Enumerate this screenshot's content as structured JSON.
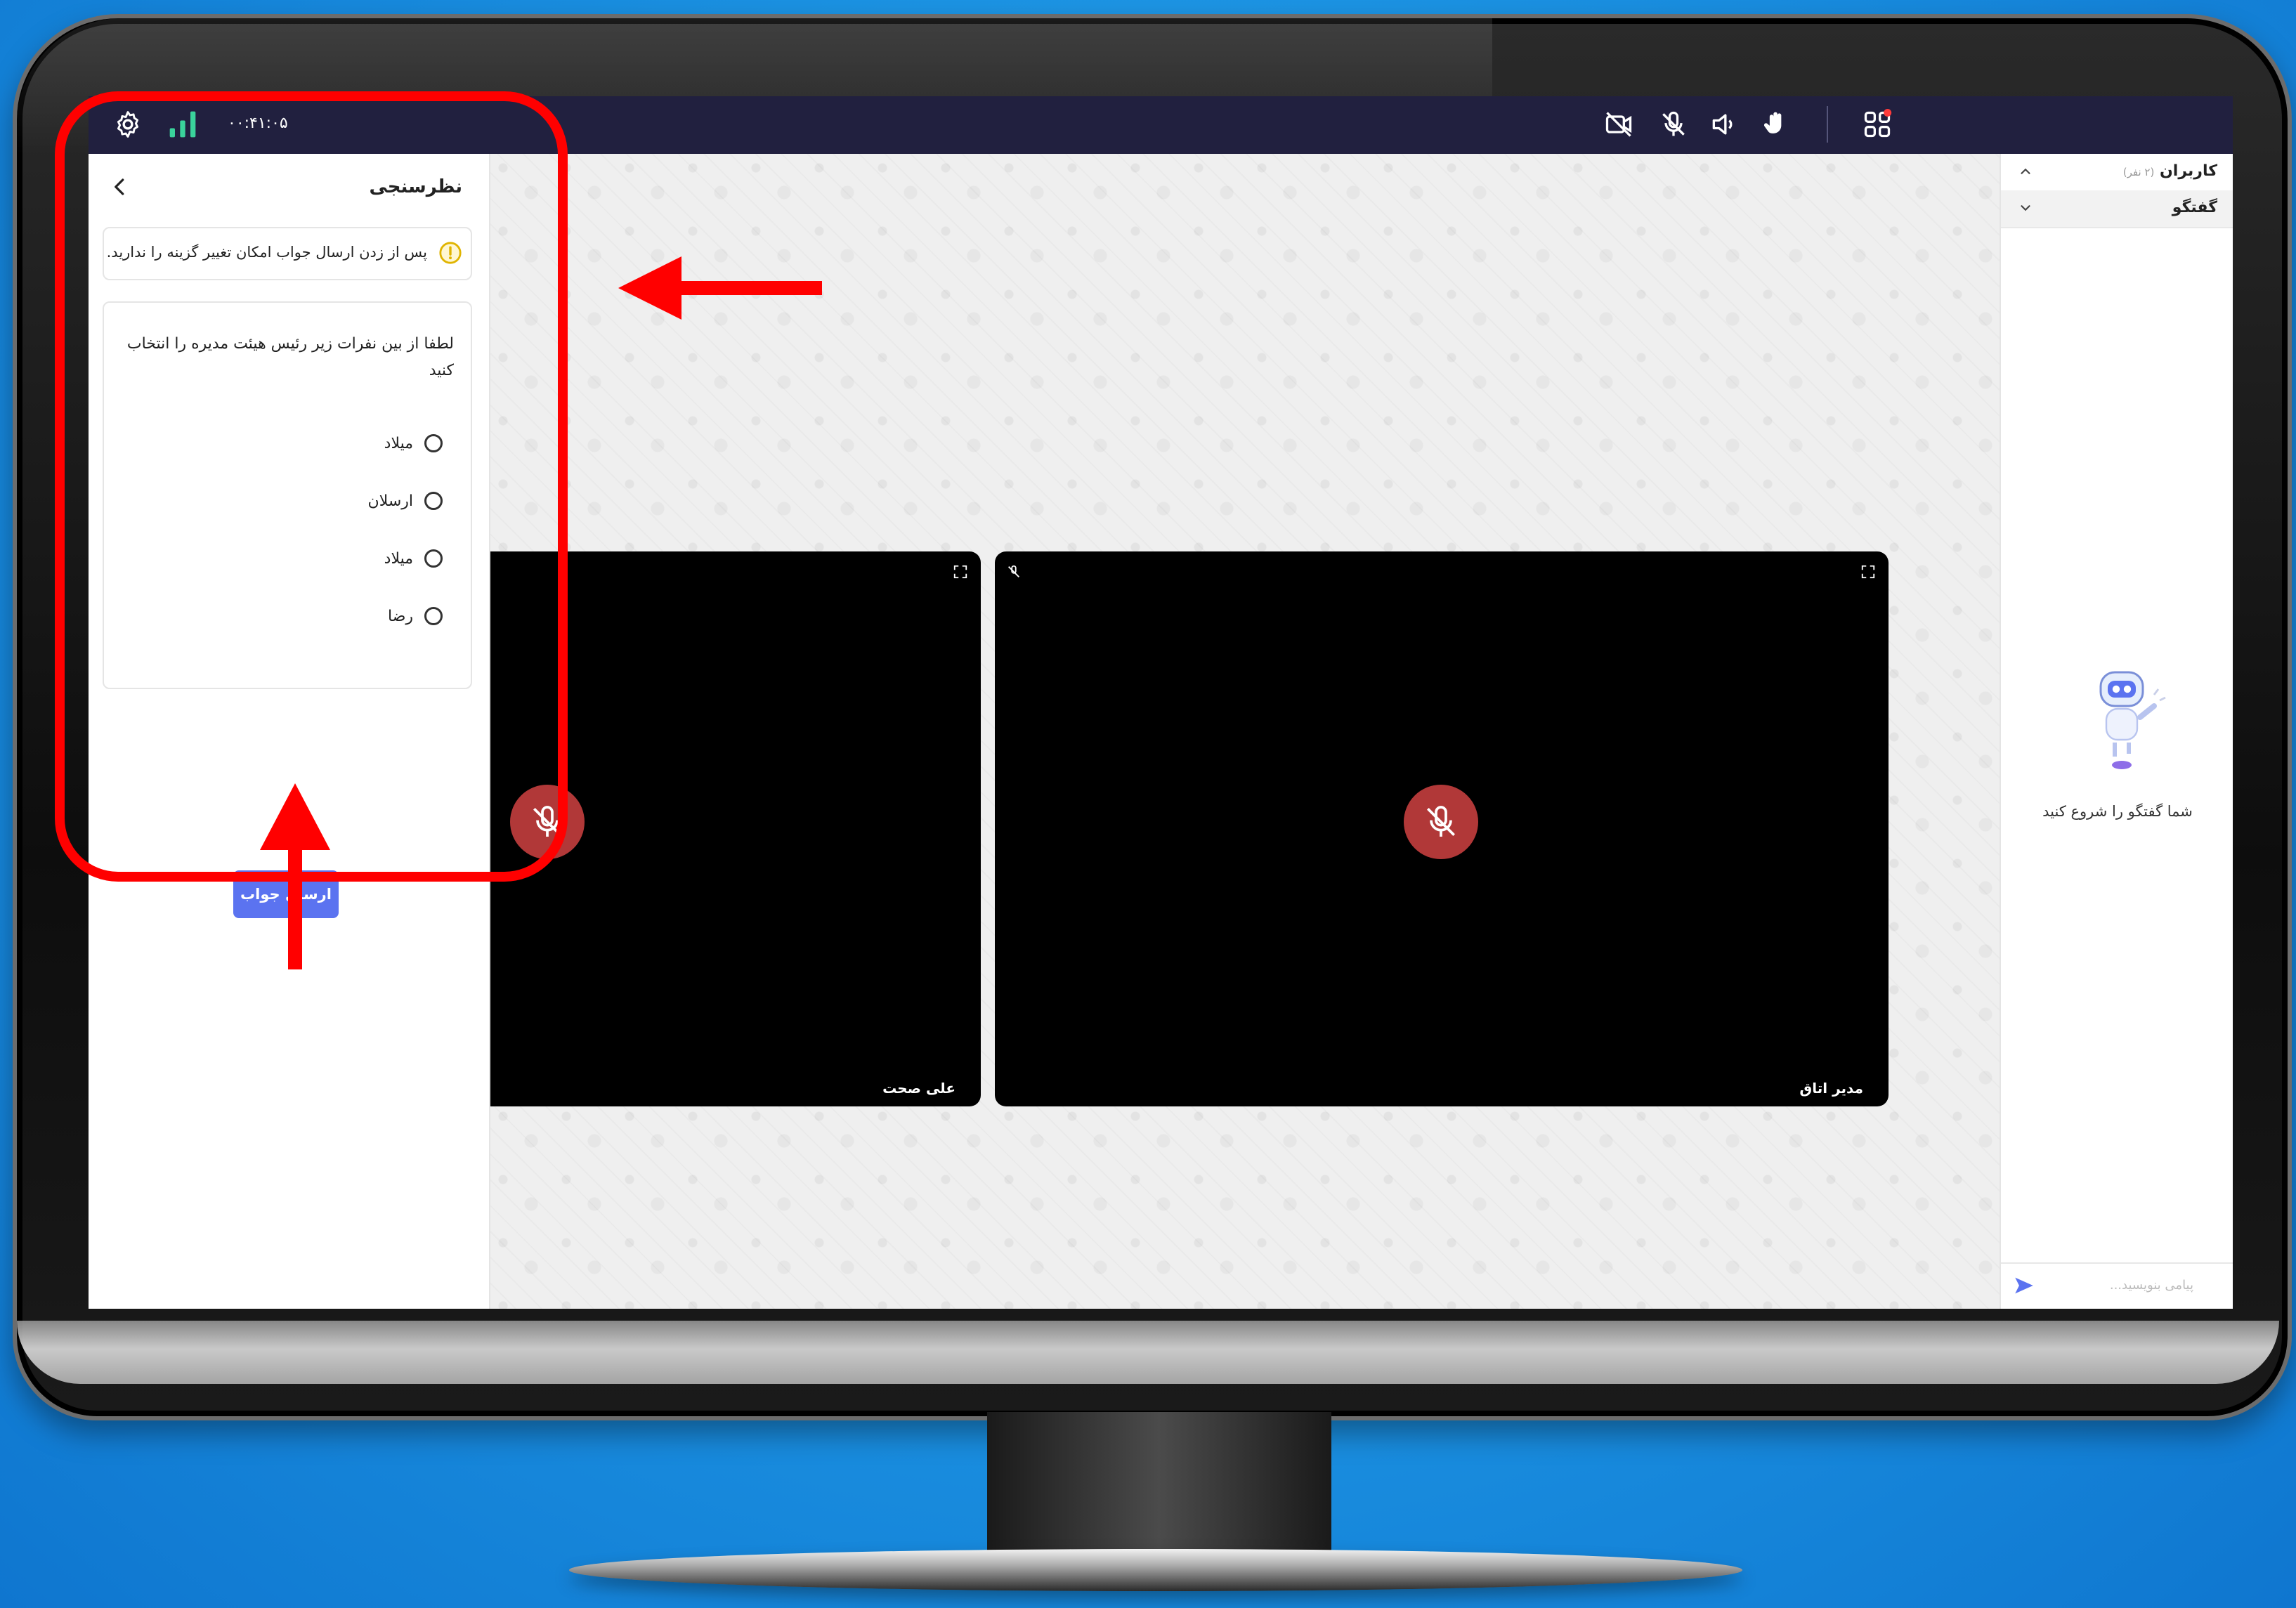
{
  "topbar": {
    "timer": "۰۰:۴۱:۰۵",
    "colors": {
      "bar": "#21203f",
      "signal": "#3ad39b",
      "notify_dot": "#ff3b3b"
    }
  },
  "poll": {
    "title": "نظرسنجی",
    "warning": "پس از زدن ارسال جواب امکان تغییر گزینه را ندارید.",
    "question": "لطفا از بین نفرات زیر رئیس هیئت مدیره را انتخاب کنید",
    "options": [
      "میلاد",
      "ارسلان",
      "میلاد",
      "رضا"
    ],
    "submit_label": "ارسال جواب",
    "submit_color": "#5b73f0"
  },
  "tiles": [
    {
      "name": "علی صحت"
    },
    {
      "name": "مدیر اتاق"
    }
  ],
  "sidebar": {
    "users_label": "کاربران",
    "users_count": "(۲ نفر)",
    "chat_label": "گفتگو",
    "empty_text": "شما گفتگو را شروع کنید",
    "message_placeholder": "پیامی بنویسید..."
  },
  "annotation_color": "#ff0000"
}
